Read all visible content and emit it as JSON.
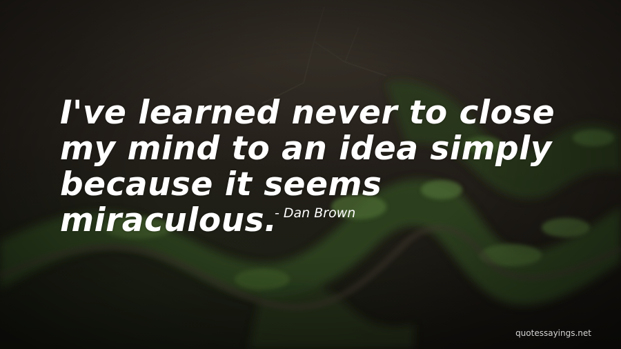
{
  "quote": {
    "text": "I've learned never to close my mind to an idea simply because it seems miraculous.",
    "author": "- Dan Brown"
  },
  "watermark": {
    "text": "quotessayings.net"
  },
  "colors": {
    "text": "#ffffff",
    "background": "#241f1a",
    "foliage": "#3e5a2a"
  }
}
